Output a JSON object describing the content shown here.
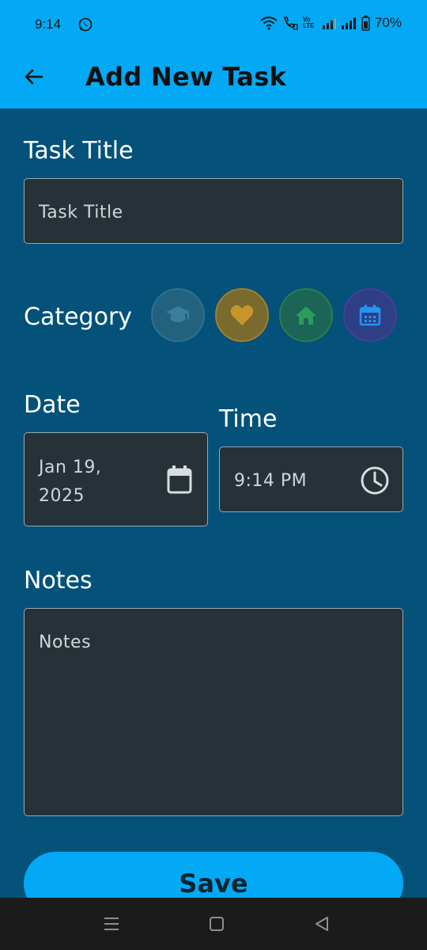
{
  "status": {
    "time": "9:14",
    "battery": "70%",
    "volte": "Vo LTE"
  },
  "appbar": {
    "title": "Add New Task",
    "back_icon": "arrow-back-icon"
  },
  "form": {
    "title_label": "Task Title",
    "title_placeholder": "Task Title",
    "category_label": "Category",
    "categories": [
      {
        "name": "study",
        "icon": "graduation-cap-icon",
        "color": "#2e7190"
      },
      {
        "name": "health",
        "icon": "heart-icon",
        "color": "#c9952a"
      },
      {
        "name": "home",
        "icon": "home-icon",
        "color": "#2e9b5b"
      },
      {
        "name": "calendar",
        "icon": "calendar-icon",
        "color": "#2196f3"
      }
    ],
    "date_label": "Date",
    "date_line1": "Jan 19,",
    "date_line2": "2025",
    "time_label": "Time",
    "time_value": "9:14 PM",
    "notes_label": "Notes",
    "notes_placeholder": "Notes"
  },
  "save_label": "Save",
  "colors": {
    "accent": "#03a9f4",
    "background": "#04527a",
    "field": "#263238"
  }
}
